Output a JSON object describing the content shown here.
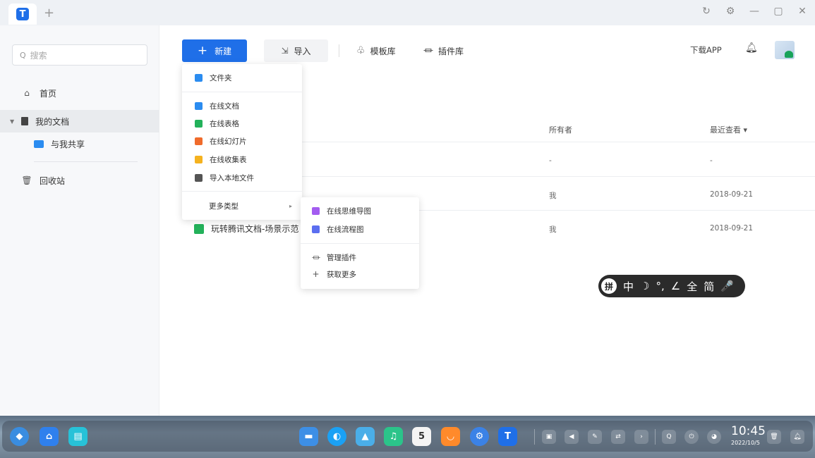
{
  "titlebar": {
    "app_logo": "T",
    "add_tab": "+",
    "controls": [
      "↻",
      "⚙",
      "—",
      "▢",
      "✕"
    ]
  },
  "sidebar": {
    "search_placeholder": "搜索",
    "home": "首页",
    "my_docs": "我的文档",
    "shared_with_me": "与我共享",
    "trash": "回收站"
  },
  "toolbar": {
    "new_label": "新建",
    "import_label": "导入",
    "templates_label": "模板库",
    "plugins_label": "插件库",
    "download_app": "下载APP"
  },
  "table": {
    "owner_header": "所有者",
    "last_viewed_header": "最近查看 ▾",
    "rows": [
      {
        "name": "",
        "owner": "-",
        "last_viewed": "-"
      },
      {
        "name": "",
        "owner": "我",
        "last_viewed": "2018-09-21"
      },
      {
        "name": "玩转腾讯文档-场景示范",
        "owner": "我",
        "last_viewed": "2018-09-21"
      }
    ]
  },
  "new_menu": {
    "folder": "文件夹",
    "online_doc": "在线文档",
    "online_sheet": "在线表格",
    "online_slides": "在线幻灯片",
    "online_form": "在线收集表",
    "import_local": "导入本地文件",
    "more_types": "更多类型"
  },
  "more_submenu": {
    "mindmap": "在线思维导图",
    "flowchart": "在线流程图",
    "manage_plugins": "管理插件",
    "get_more": "获取更多"
  },
  "ime": {
    "pin": "拼",
    "items": [
      "中",
      "☽",
      "°,",
      "∠",
      "全",
      "简",
      "🎤"
    ]
  },
  "dock": {
    "calendar_day": "5",
    "clock_time": "10:45",
    "clock_date": "2022/10/5"
  },
  "colors": {
    "accent": "#1f6fe8",
    "folder": "#2b8cf0",
    "doc": "#2b8cf0",
    "sheet": "#23b15a",
    "slides": "#f06b2b",
    "form": "#f5b21f",
    "mindmap": "#a35cf0",
    "flowchart": "#5b6ef0"
  }
}
